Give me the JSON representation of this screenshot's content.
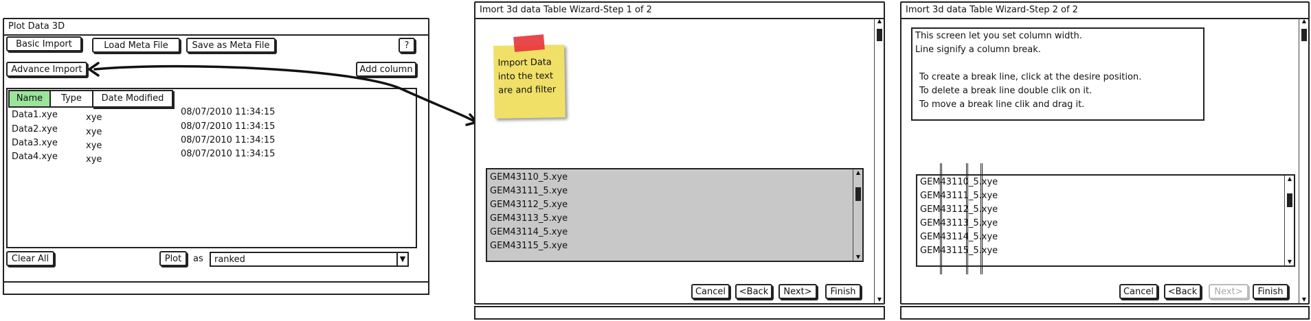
{
  "plot3d": {
    "title": "Plot Data 3D",
    "basic_import": "Basic Import",
    "load_meta": "Load Meta File",
    "save_meta": "Save as Meta File",
    "help": "?",
    "advance_import": "Advance Import",
    "add_column": "Add column",
    "tabs": [
      "Name",
      "Type",
      "Date Modified"
    ],
    "rows": [
      {
        "name": "Data1.xye",
        "type": "xye",
        "date": "08/07/2010 11:34:15"
      },
      {
        "name": "Data2.xye",
        "type": "xye",
        "date": "08/07/2010 11:34:15"
      },
      {
        "name": "Data3.xye",
        "type": "xye",
        "date": "08/07/2010 11:34:15"
      },
      {
        "name": "Data4.xye",
        "type": "xye",
        "date": "08/07/2010 11:34:15"
      }
    ],
    "clear_all": "Clear All",
    "plot": "Plot",
    "as_label": "as",
    "plot_type": "ranked"
  },
  "wizard1": {
    "title": "Imort 3d data Table Wizard-Step 1 of 2",
    "note": [
      "Import Data",
      "into the text",
      "are and filter"
    ],
    "files": [
      "GEM43110_5.xye",
      "GEM43111_5.xye",
      "GEM43112_5.xye",
      "GEM43113_5.xye",
      "GEM43114_5.xye",
      "GEM43115_5.xye"
    ],
    "cancel": "Cancel",
    "back": "<Back",
    "next": "Next>",
    "finish": "Finish"
  },
  "wizard2": {
    "title": "Imort 3d data Table Wizard-Step 2 of 2",
    "instructions": [
      "This screen let you set column width.",
      "Line signify a column break.",
      "",
      "To create a break line, click at the desire position.",
      "To delete a break line double clik on it.",
      "To move a break line clik and drag it."
    ],
    "files": [
      {
        "a": "GEM",
        "b": "43110",
        "c": "_5.",
        "d": "xye"
      },
      {
        "a": "GEM",
        "b": "43111",
        "c": "_5.",
        "d": "xye"
      },
      {
        "a": "GEM",
        "b": "43112",
        "c": "_5.",
        "d": "xye"
      },
      {
        "a": "GEM",
        "b": "43113",
        "c": "_5.",
        "d": "xye"
      },
      {
        "a": "GEM",
        "b": "43114",
        "c": "_5.",
        "d": "xye"
      },
      {
        "a": "GEM",
        "b": "43115",
        "c": "_5.",
        "d": "xye"
      }
    ],
    "cancel": "Cancel",
    "back": "<Back",
    "next": "Next>",
    "finish": "Finish"
  },
  "colors": {
    "active_tab": "#9be59b",
    "list_bg": "#c8c8c8",
    "note_yellow": "#f0e068",
    "note_tape": "#e8333a"
  }
}
